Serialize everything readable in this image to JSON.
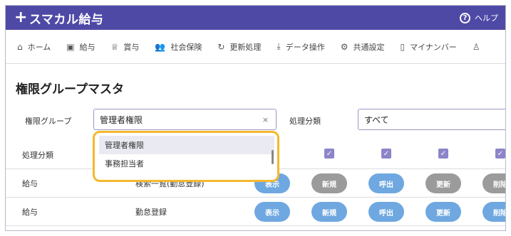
{
  "app": {
    "brand_plus": "+",
    "brand_name": "スマカル給与"
  },
  "header": {
    "help_label": "ヘルプ",
    "help_icon": "question-circle-icon"
  },
  "nav": [
    {
      "label": "ホーム",
      "icon": "home-icon"
    },
    {
      "label": "給与",
      "icon": "payroll-icon"
    },
    {
      "label": "賞与",
      "icon": "trophy-icon"
    },
    {
      "label": "社会保険",
      "icon": "people-icon"
    },
    {
      "label": "更新処理",
      "icon": "refresh-icon"
    },
    {
      "label": "データ操作",
      "icon": "download-icon"
    },
    {
      "label": "共通設定",
      "icon": "gear-icon"
    },
    {
      "label": "マイナンバー",
      "icon": "id-card-icon"
    }
  ],
  "page": {
    "title": "権限グループマスタ"
  },
  "filters": {
    "group_label": "権限グループ",
    "group_value": "管理者権限",
    "clear_symbol": "×",
    "category_label": "処理分類",
    "category_value": "すべて"
  },
  "dropdown": {
    "options": [
      "管理者権限",
      "事務担当者"
    ],
    "highlighted": 0
  },
  "table": {
    "header_label": "処理分類",
    "rows": [
      {
        "category": "給与",
        "process": "検索一覧(勤怠登録)",
        "buttons": [
          "表示",
          "新規",
          "呼出",
          "更新",
          "削除"
        ]
      },
      {
        "category": "給与",
        "process": "勤怠登録",
        "buttons": [
          "表示",
          "新規",
          "呼出",
          "更新",
          "削除"
        ]
      }
    ]
  },
  "colors": {
    "header_bg": "#4f49a6",
    "highlight": "#f5b82e",
    "button_on": "#6fa8e0",
    "button_off": "#9b9b9b",
    "checkbox": "#8c85c9"
  }
}
